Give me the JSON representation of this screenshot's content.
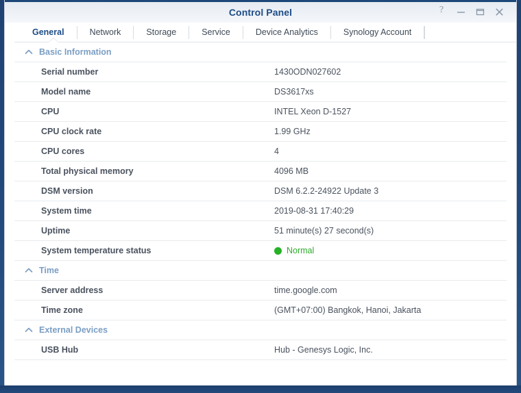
{
  "window": {
    "title": "Control Panel",
    "controls": [
      {
        "name": "help-button",
        "glyph": "?"
      },
      {
        "name": "minimize-button",
        "glyph": "–"
      },
      {
        "name": "maximize-button",
        "glyph": "□"
      },
      {
        "name": "close-button",
        "glyph": "✕"
      }
    ]
  },
  "tabs": [
    {
      "label": "General",
      "active": true
    },
    {
      "label": "Network",
      "active": false
    },
    {
      "label": "Storage",
      "active": false
    },
    {
      "label": "Service",
      "active": false
    },
    {
      "label": "Device Analytics",
      "active": false
    },
    {
      "label": "Synology Account",
      "active": false
    }
  ],
  "sections": [
    {
      "title": "Basic Information",
      "collapse_icon": "chevron-up-icon",
      "rows": [
        {
          "label": "Serial number",
          "value": "1430ODN027602"
        },
        {
          "label": "Model name",
          "value": "DS3617xs"
        },
        {
          "label": "CPU",
          "value": "INTEL Xeon D-1527"
        },
        {
          "label": "CPU clock rate",
          "value": "1.99 GHz"
        },
        {
          "label": "CPU cores",
          "value": "4"
        },
        {
          "label": "Total physical memory",
          "value": "4096 MB"
        },
        {
          "label": "DSM version",
          "value": "DSM 6.2.2-24922 Update 3"
        },
        {
          "label": "System time",
          "value": "2019-08-31 17:40:29"
        },
        {
          "label": "Uptime",
          "value": "51 minute(s) 27 second(s)"
        },
        {
          "label": "System temperature status",
          "value": "Normal",
          "status": "normal"
        }
      ]
    },
    {
      "title": "Time",
      "collapse_icon": "chevron-up-icon",
      "rows": [
        {
          "label": "Server address",
          "value": "time.google.com"
        },
        {
          "label": "Time zone",
          "value": "(GMT+07:00) Bangkok, Hanoi, Jakarta"
        }
      ]
    },
    {
      "title": "External Devices",
      "collapse_icon": "chevron-up-icon",
      "rows": [
        {
          "label": "USB Hub",
          "value": "Hub - Genesys Logic, Inc."
        }
      ]
    }
  ],
  "colors": {
    "title_blue": "#1d4c86",
    "section_header_blue": "#7b9ec4",
    "label_gray": "#4a525e",
    "status_green": "#2faa2f",
    "status_dot_green": "#25b225",
    "desktop_blue": "#22497d"
  }
}
